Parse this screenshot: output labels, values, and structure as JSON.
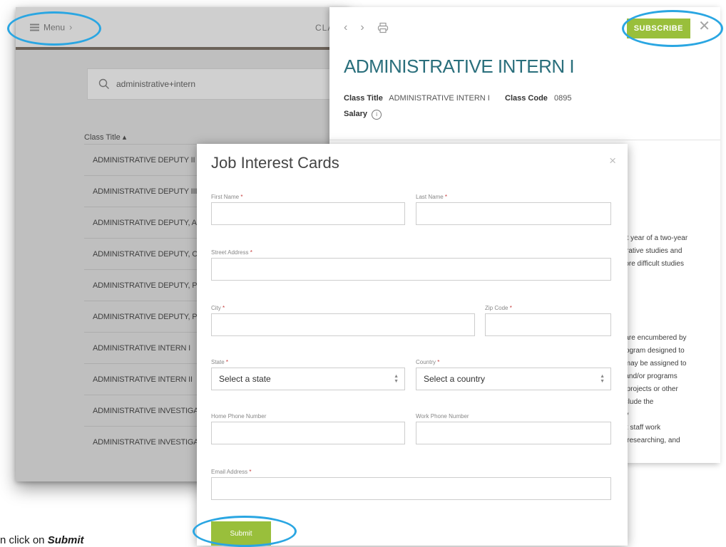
{
  "browse": {
    "menu_label": "Menu",
    "center_label": "CLA",
    "search_value": "administrative+intern",
    "column_header": "Class Title ▴",
    "items": [
      "ADMINISTRATIVE DEPUTY II",
      "ADMINISTRATIVE DEPUTY III",
      "ADMINISTRATIVE DEPUTY, ALT",
      "ADMINISTRATIVE DEPUTY, CHI",
      "ADMINISTRATIVE DEPUTY, PUE",
      "ADMINISTRATIVE DEPUTY, PUE",
      "ADMINISTRATIVE INTERN I",
      "ADMINISTRATIVE INTERN II",
      "ADMINISTRATIVE INVESTIGATO",
      "ADMINISTRATIVE INVESTIGATO"
    ]
  },
  "detail": {
    "nav_prev": "‹",
    "nav_next": "›",
    "subscribe_label": "SUBSCRIBE",
    "close_label": "✕",
    "title": "ADMINISTRATIVE INTERN I",
    "class_title_label": "Class Title",
    "class_title_value": "ADMINISTRATIVE INTERN I",
    "class_code_label": "Class Code",
    "class_code_value": "0895",
    "salary_label": "Salary",
    "body_lines_1": [
      "irst year of a two-year",
      "istrative studies and",
      "more difficult studies"
    ],
    "body_lines_2": [
      "d are encumbered by",
      "program designed to",
      "s may be assigned to",
      "n and/or programs",
      "al projects or other",
      "include the",
      "nty",
      "lex staff work",
      "g, researching, and"
    ]
  },
  "modal": {
    "title": "Job Interest Cards",
    "close_label": "×",
    "first_name_label": "First Name",
    "last_name_label": "Last Name",
    "street_label": "Street Address",
    "city_label": "City",
    "zip_label": "Zip Code",
    "state_label": "State",
    "state_value": "Select a state",
    "country_label": "Country",
    "country_value": "Select a country",
    "home_phone_label": "Home Phone Number",
    "work_phone_label": "Work Phone Number",
    "email_label": "Email Address",
    "required_mark": "*",
    "submit_label": "Submit"
  },
  "caption": {
    "prefix": "n click on ",
    "emphasis": "Submit"
  },
  "colors": {
    "accent_green": "#99bf3b",
    "title_teal": "#2a6f7c",
    "annotation_blue": "#2aa6e2"
  },
  "icons": [
    "menu-icon",
    "chevron-right-icon",
    "search-icon",
    "print-icon",
    "close-icon",
    "info-icon",
    "select-caret-icon"
  ]
}
